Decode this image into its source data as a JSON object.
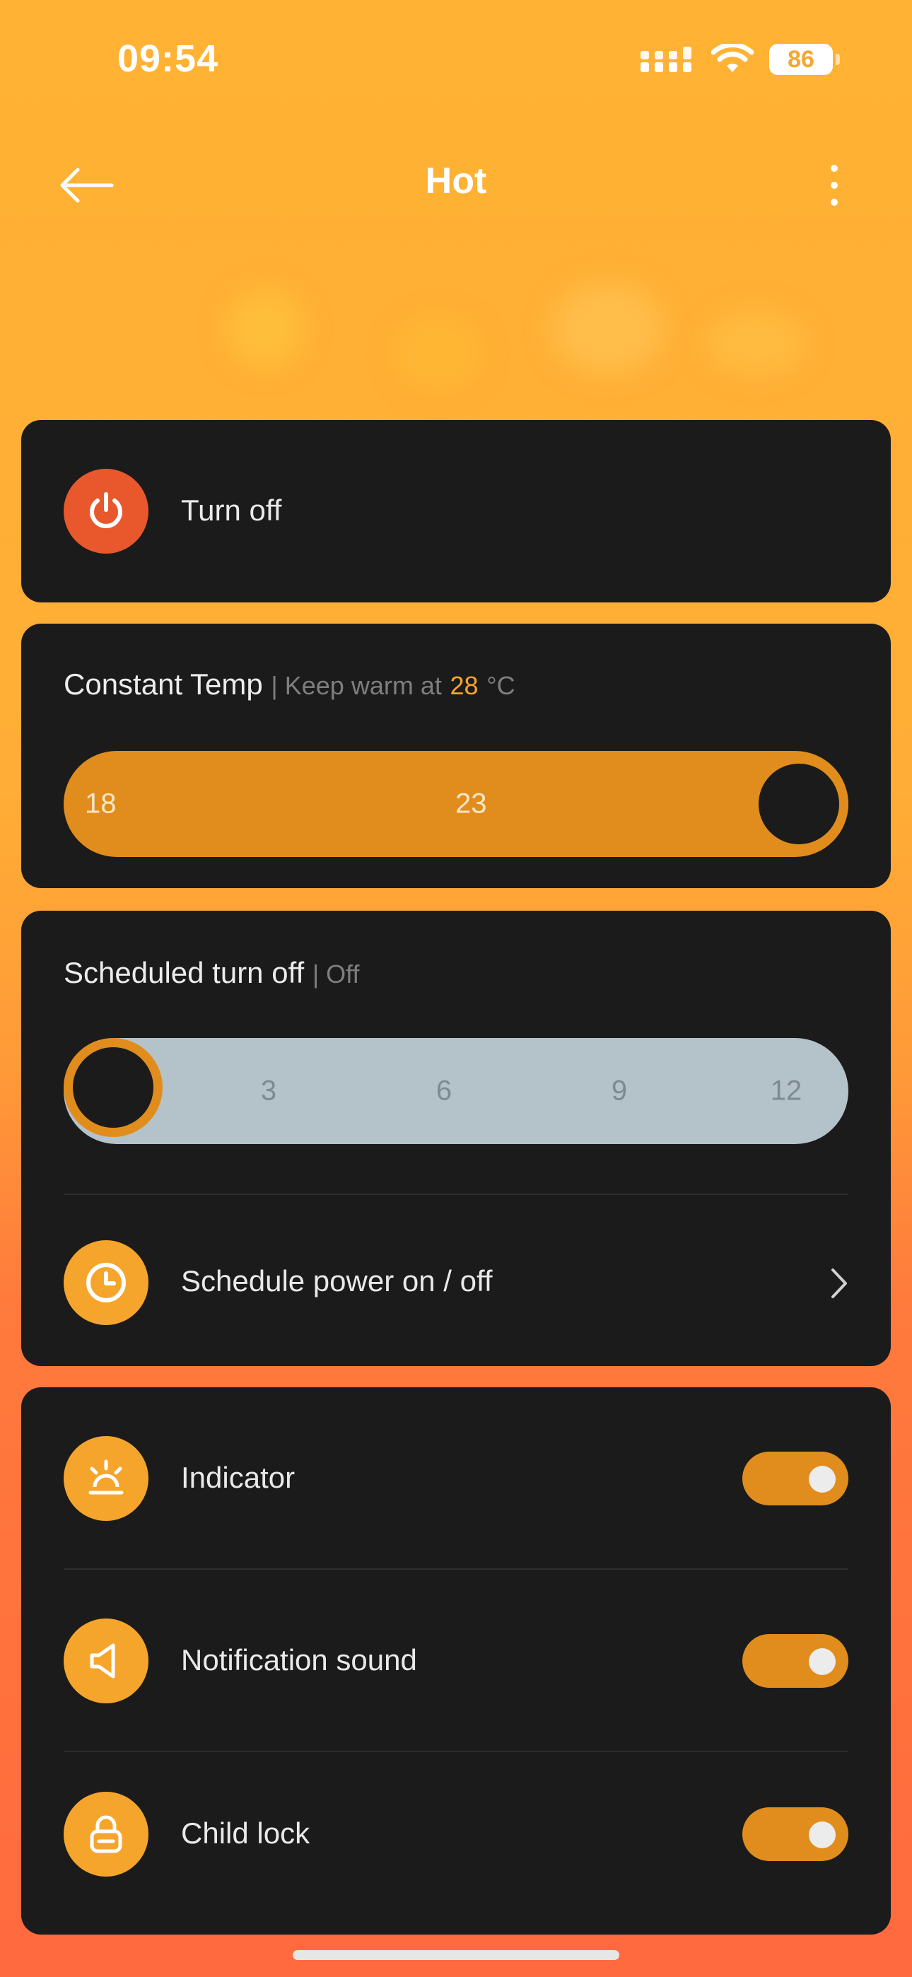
{
  "status_bar": {
    "time": "09:54",
    "battery": "86"
  },
  "header": {
    "title": "Hot"
  },
  "power": {
    "label": "Turn off"
  },
  "constant_temp": {
    "title": "Constant Temp",
    "sub_prefix": "| Keep warm at",
    "value": "28",
    "unit": "°C",
    "ticks": [
      "18",
      "23"
    ],
    "current": 28
  },
  "scheduled_off": {
    "title": "Scheduled turn off",
    "status": "| Off",
    "ticks": [
      "3",
      "6",
      "9",
      "12"
    ]
  },
  "schedule_power": {
    "label": "Schedule power on / off"
  },
  "settings": [
    {
      "label": "Indicator",
      "on": true
    },
    {
      "label": "Notification sound",
      "on": true
    },
    {
      "label": "Child lock",
      "on": true
    }
  ],
  "colors": {
    "accent": "#f6a52c",
    "power": "#e8582c",
    "card": "#1b1b1b"
  }
}
